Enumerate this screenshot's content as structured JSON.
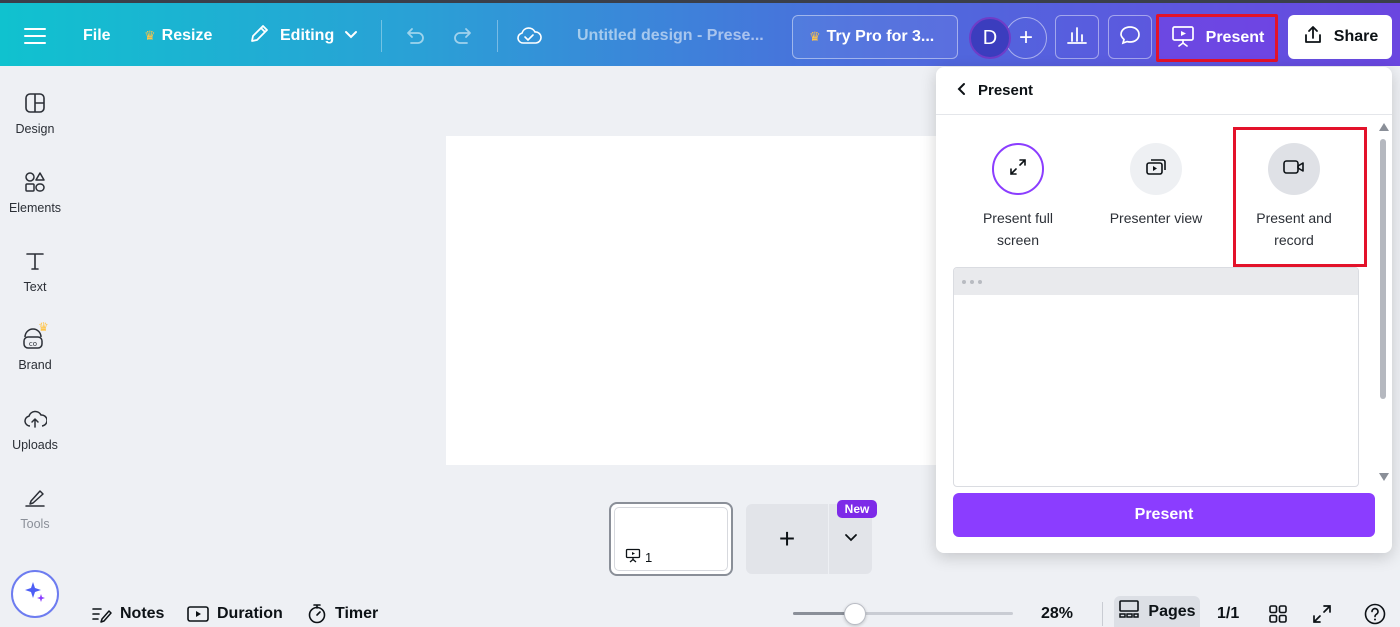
{
  "topbar": {
    "file_label": "File",
    "resize_label": "Resize",
    "editing_label": "Editing",
    "doc_title": "Untitled design - Prese...",
    "try_pro_label": "Try Pro for 3...",
    "avatar_initial": "D",
    "present_label": "Present",
    "share_label": "Share"
  },
  "sidebar": {
    "items": [
      {
        "label": "Design"
      },
      {
        "label": "Elements"
      },
      {
        "label": "Text"
      },
      {
        "label": "Brand"
      },
      {
        "label": "Uploads"
      },
      {
        "label": "Tools"
      }
    ]
  },
  "page_strip": {
    "thumb_number": "1",
    "new_badge": "New"
  },
  "bottombar": {
    "notes_label": "Notes",
    "duration_label": "Duration",
    "timer_label": "Timer",
    "zoom_value": "28%",
    "zoom_fraction": 0.28,
    "pages_label": "Pages",
    "page_count": "1/1"
  },
  "present_panel": {
    "title": "Present",
    "options": [
      {
        "label": "Present full screen",
        "selected": true
      },
      {
        "label": "Presenter view",
        "selected": false
      },
      {
        "label": "Present and record",
        "selected": false
      }
    ],
    "button_label": "Present"
  },
  "colors": {
    "accent": "#8b3dff",
    "highlight": "#e3122a",
    "crown": "#ffc447"
  }
}
